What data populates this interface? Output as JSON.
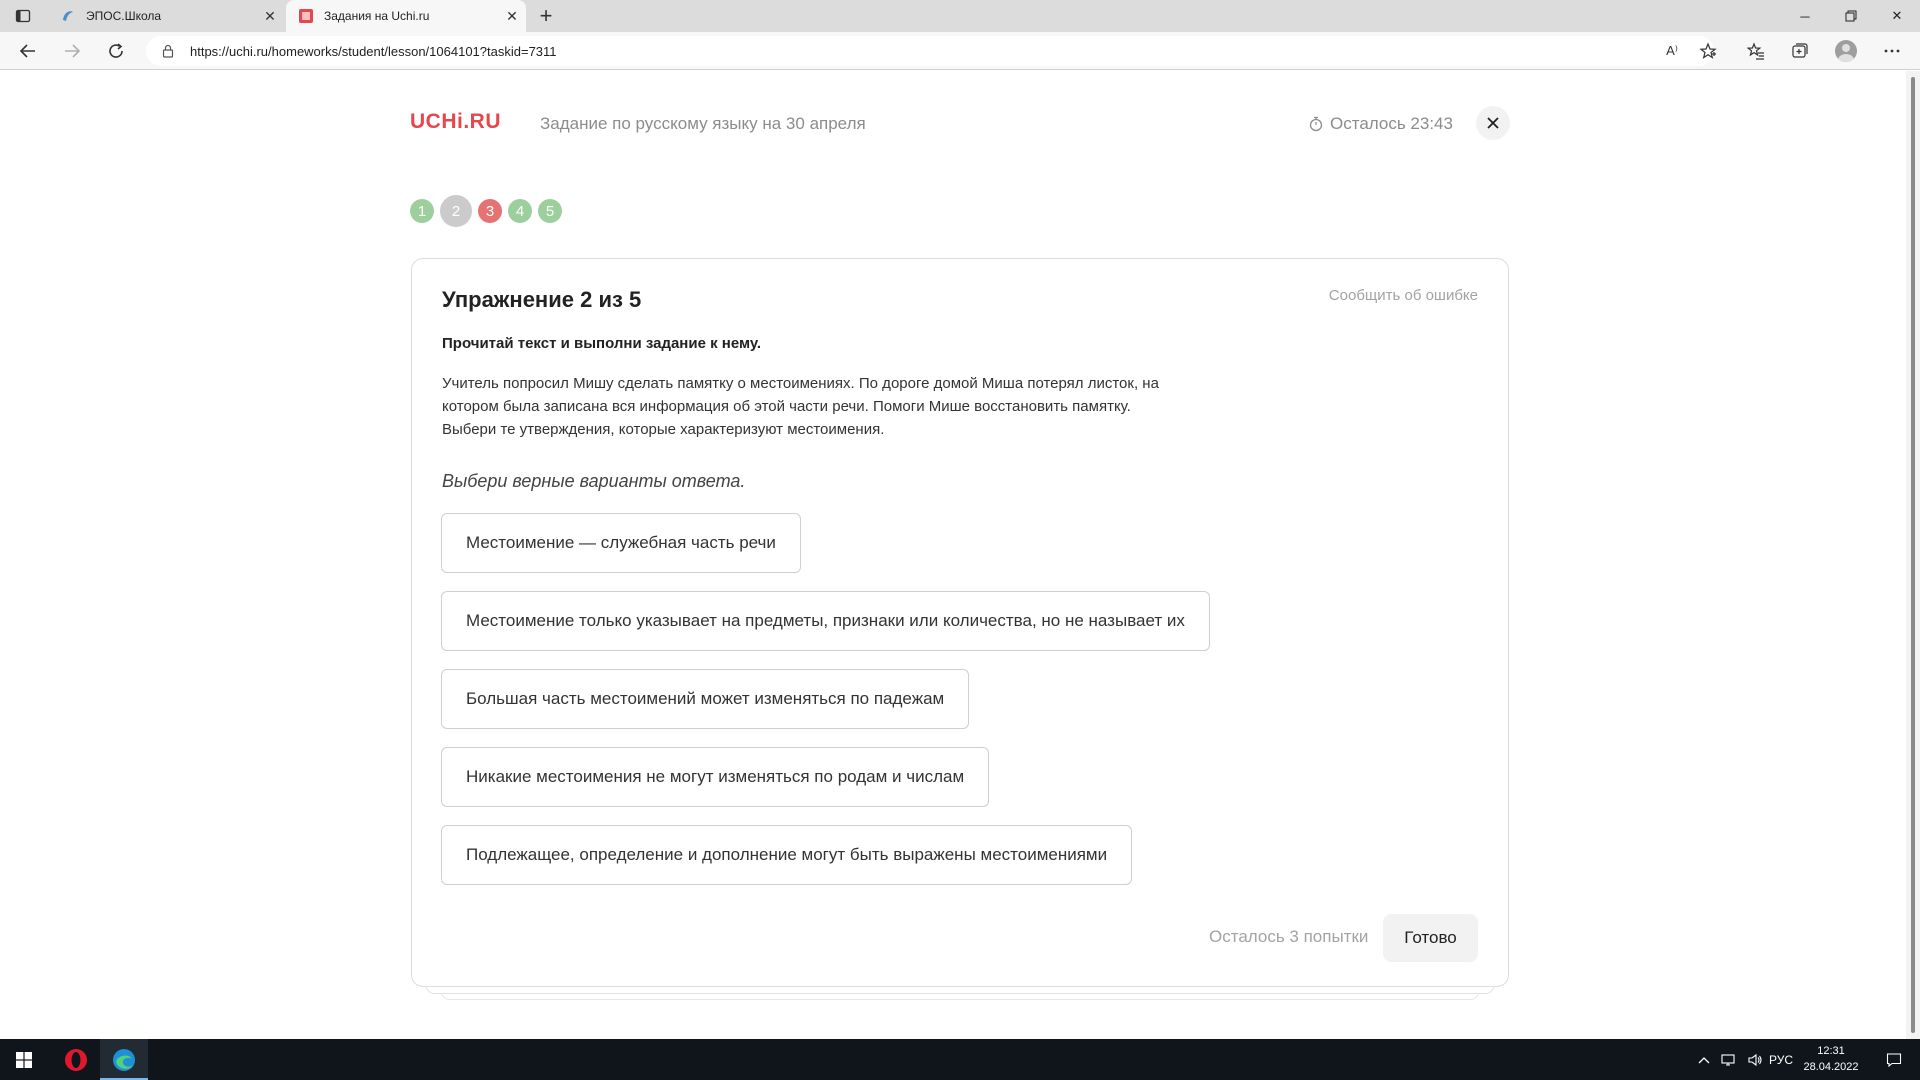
{
  "browser": {
    "tabs": [
      {
        "title": "ЭПОС.Школа",
        "active": false
      },
      {
        "title": "Задания на Uchi.ru",
        "active": true
      }
    ],
    "url": "https://uchi.ru/homeworks/student/lesson/1064101?taskid=7311",
    "reader_icon_text": "A⁾"
  },
  "header": {
    "logo": "UCHi.RU",
    "title": "Задание по русскому языку на 30 апреля",
    "timer": "Осталось 23:43"
  },
  "steps": [
    {
      "label": "1",
      "status": "correct",
      "color": "#9ccf9b"
    },
    {
      "label": "2",
      "status": "current",
      "color": "#cbcbcb"
    },
    {
      "label": "3",
      "status": "wrong",
      "color": "#e57373"
    },
    {
      "label": "4",
      "status": "correct",
      "color": "#9ccf9b"
    },
    {
      "label": "5",
      "status": "correct",
      "color": "#9ccf9b"
    }
  ],
  "task": {
    "title": "Упражнение 2 из 5",
    "report_link": "Сообщить об ошибке",
    "instruction": "Прочитай текст и выполни задание к нему.",
    "body_lines": [
      "Учитель попросил Мишу сделать памятку о местоимениях. По дороге домой Миша потерял листок, на",
      "котором была записана вся информация об этой части речи. Помоги Мише восстановить памятку.",
      "Выбери те утверждения, которые характеризуют местоимения."
    ],
    "hint": "Выбери верные варианты ответа.",
    "options": [
      "Местоимение — служебная часть речи",
      "Местоимение только указывает на предметы, признаки или количества, но не называет их",
      "Большая часть местоимений может изменяться по падежам",
      "Никакие местоимения не могут изменяться по родам и числам",
      "Подлежащее, определение и дополнение могут быть выражены местоимениями"
    ],
    "attempts": "Осталось 3 попытки",
    "submit_label": "Готово"
  },
  "taskbar": {
    "language": "РУС",
    "time": "12:31",
    "date": "28.04.2022"
  },
  "colors": {
    "brand": "#e4474e",
    "taskbar": "#10151c"
  }
}
